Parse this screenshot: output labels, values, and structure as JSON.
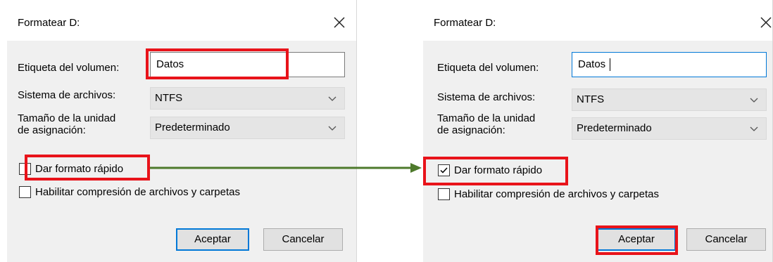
{
  "dialog_before": {
    "title": "Formatear D:",
    "volume_label_label": "Etiqueta del volumen:",
    "volume_label_value": "Datos",
    "filesystem_label": "Sistema de archivos:",
    "filesystem_value": "NTFS",
    "unit_size_label_line1": "Tamaño de la unidad",
    "unit_size_label_line2": "de asignación:",
    "unit_size_value": "Predeterminado",
    "quick_format_label": "Dar formato rápido",
    "quick_format_checked": false,
    "compression_label": "Habilitar compresión de archivos y carpetas",
    "compression_checked": false,
    "ok_label": "Aceptar",
    "cancel_label": "Cancelar"
  },
  "dialog_after": {
    "title": "Formatear D:",
    "volume_label_label": "Etiqueta del volumen:",
    "volume_label_value": "Datos",
    "filesystem_label": "Sistema de archivos:",
    "filesystem_value": "NTFS",
    "unit_size_label_line1": "Tamaño de la unidad",
    "unit_size_label_line2": "de asignación:",
    "unit_size_value": "Predeterminado",
    "quick_format_label": "Dar formato rápido",
    "quick_format_checked": true,
    "compression_label": "Habilitar compresión de archivos y carpetas",
    "compression_checked": false,
    "ok_label": "Aceptar",
    "cancel_label": "Cancelar"
  },
  "colors": {
    "highlight": "#e8131a",
    "arrow": "#4e7a2c",
    "focus_border": "#0078d7"
  }
}
